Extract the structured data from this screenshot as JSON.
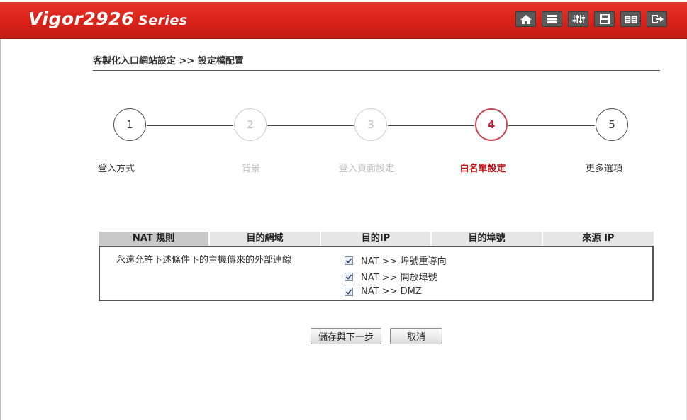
{
  "header": {
    "brand_model": "Vigor2926",
    "brand_series": "Series",
    "icons": [
      "home-icon",
      "list-icon",
      "sliders-icon",
      "save-icon",
      "book-icon",
      "logout-icon"
    ]
  },
  "breadcrumb": "客製化入口網站設定 >> 設定檔配置",
  "steps": [
    {
      "num": "1",
      "label": "登入方式",
      "state": "normal"
    },
    {
      "num": "2",
      "label": "背景",
      "state": "dim"
    },
    {
      "num": "3",
      "label": "登入頁面設定",
      "state": "dim"
    },
    {
      "num": "4",
      "label": "白名單設定",
      "state": "active"
    },
    {
      "num": "5",
      "label": "更多選項",
      "state": "normal"
    }
  ],
  "tabs": [
    "NAT 規則",
    "目的網域",
    "目的IP",
    "目的埠號",
    "來源 IP"
  ],
  "selected_tab": "NAT 規則",
  "description": "永遠允許下述條件下的主機傳來的外部連線",
  "options": [
    {
      "label": "NAT >> 埠號重導向",
      "checked": true
    },
    {
      "label": "NAT >> 開放埠號",
      "checked": true
    },
    {
      "label": "NAT >> DMZ",
      "checked": true
    }
  ],
  "buttons": {
    "save_next": "儲存與下一步",
    "cancel": "取消"
  },
  "colors": {
    "header_red": "#d9231a",
    "active_step": "#c2223a"
  }
}
